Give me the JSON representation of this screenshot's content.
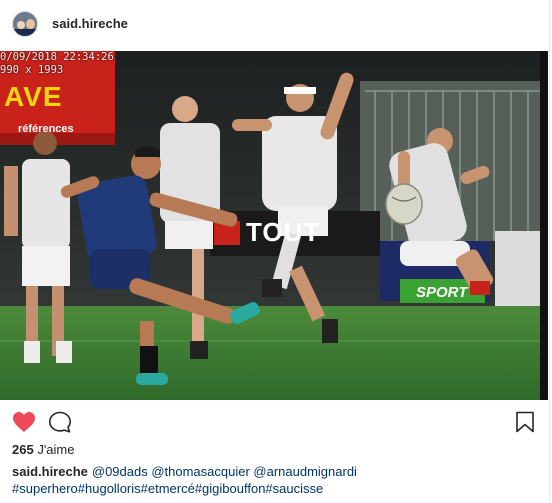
{
  "header": {
    "username": "said.hireche",
    "avatar_icon": "avatar-photo"
  },
  "photo": {
    "timestamp_line1": "0/09/2018 22:34:26",
    "timestamp_line2": "990 x 1993",
    "banner_text": "AVE",
    "banner_subtext": "références",
    "board_text": "TOUT",
    "sport_text": "SPORT",
    "colors": {
      "grass": "#3f7b35",
      "crowd": "#2b3030",
      "banner": "#c8221b",
      "blue_jersey": "#213a7a",
      "white_jersey": "#e4e4e4"
    }
  },
  "actions": {
    "like_icon": "heart-icon-filled",
    "like_color": "#ed4956",
    "comment_icon": "comment-icon",
    "save_icon": "bookmark-icon"
  },
  "likes": {
    "count": "265",
    "label": "J'aime"
  },
  "caption": {
    "username": "said.hireche",
    "mentions": "@09dads @thomasacquier @arnaudmignardi",
    "hashtags": "#superhero#hugolloris#etmercé#gigibouffon#saucisse"
  }
}
